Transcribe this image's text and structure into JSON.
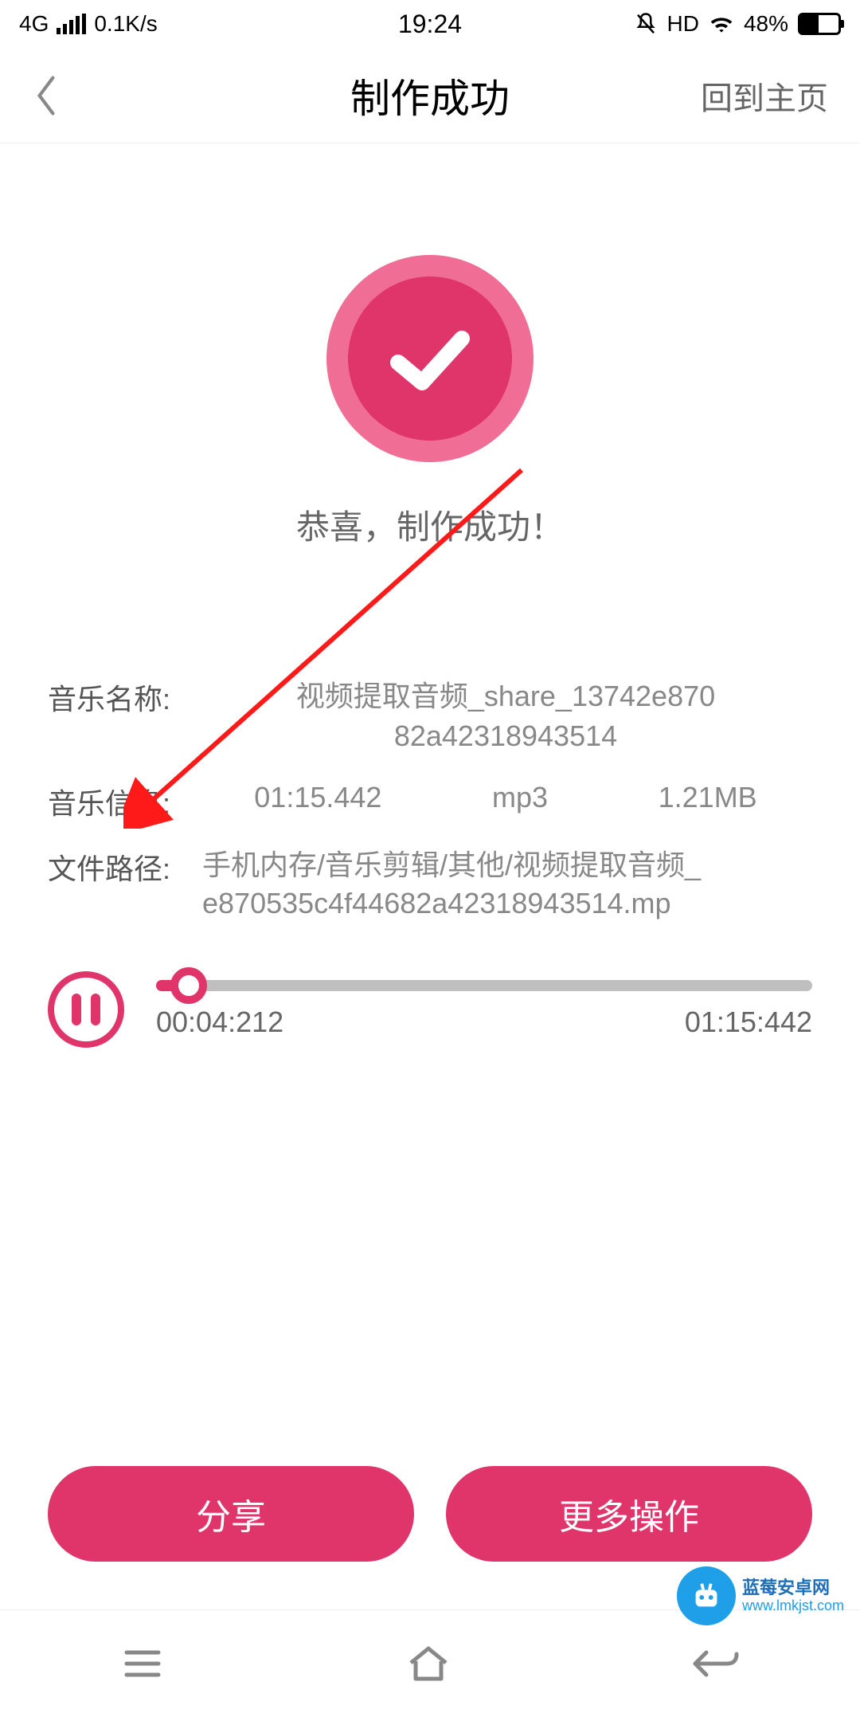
{
  "statusbar": {
    "network_type": "4G",
    "data_rate": "0.1K/s",
    "time": "19:24",
    "hd_label": "HD",
    "battery_pct": "48%"
  },
  "header": {
    "title": "制作成功",
    "home_link": "回到主页"
  },
  "success": {
    "message": "恭喜，制作成功！"
  },
  "info": {
    "name_label": "音乐名称:",
    "name_value_line1": "视频提取音频_share_13742e870",
    "name_value_line2": "82a42318943514",
    "meta_label": "音乐信息:",
    "duration": "01:15.442",
    "format": "mp3",
    "size": "1.21MB",
    "path_label": "文件路径:",
    "path_value_line1": "手机内存/音乐剪辑/其他/视频提取音频_",
    "path_value_line2": "e870535c4f44682a42318943514.mp"
  },
  "player": {
    "current_time": "00:04:212",
    "total_time": "01:15:442"
  },
  "actions": {
    "share": "分享",
    "more": "更多操作"
  },
  "watermark": {
    "site_name": "蓝莓安卓网",
    "site_url": "www.lmkjst.com"
  }
}
